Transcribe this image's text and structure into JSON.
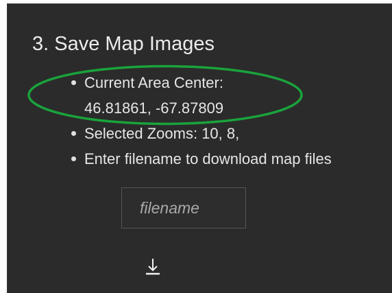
{
  "section": {
    "title": "3. Save Map Images"
  },
  "info": {
    "center_label": "Current Area Center:",
    "center_coords": "46.81861, -67.87809",
    "zooms": "Selected Zooms: 10, 8,",
    "instruction": "Enter filename to download map files"
  },
  "filename_input": {
    "placeholder": "filename",
    "value": ""
  },
  "download_button": {
    "icon": "download-icon"
  },
  "annotation": {
    "color": "#1aa33c"
  }
}
